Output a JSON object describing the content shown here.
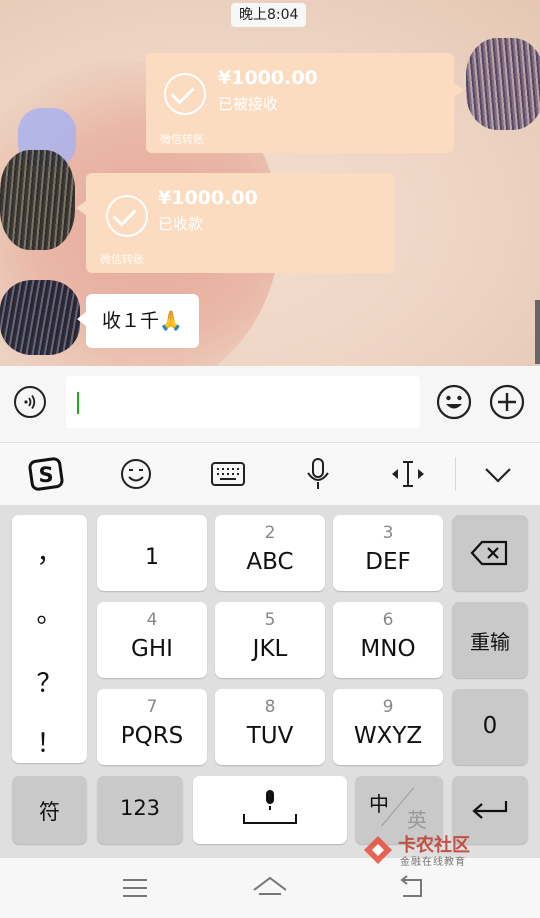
{
  "chat": {
    "timestamp": "晚上8:04",
    "transfers": [
      {
        "amount": "¥1000.00",
        "status": "已被接收",
        "footer": "微信转账"
      },
      {
        "amount": "¥1000.00",
        "status": "已收款",
        "footer": "微信转账"
      }
    ],
    "message": "收１千🙏"
  },
  "input_bar": {
    "input_value": ""
  },
  "toolbar": {
    "icons": [
      "sogou-logo-icon",
      "emoji-face-icon",
      "keyboard-icon",
      "microphone-icon",
      "cursor-move-icon",
      "chevron-down-icon"
    ]
  },
  "keyboard": {
    "punctuation": [
      "，",
      "。",
      "？",
      "！"
    ],
    "keys": [
      {
        "num": "",
        "letters": "1"
      },
      {
        "num": "2",
        "letters": "ABC"
      },
      {
        "num": "3",
        "letters": "DEF"
      },
      {
        "num": "4",
        "letters": "GHI"
      },
      {
        "num": "5",
        "letters": "JKL"
      },
      {
        "num": "6",
        "letters": "MNO"
      },
      {
        "num": "7",
        "letters": "PQRS"
      },
      {
        "num": "8",
        "letters": "TUV"
      },
      {
        "num": "9",
        "letters": "WXYZ"
      }
    ],
    "reenter_label": "重输",
    "zero_label": "0",
    "symbol_label": "符",
    "numeric_label": "123",
    "zh_label": "中",
    "en_label": "英"
  },
  "watermark": {
    "title": "卡农社区",
    "subtitle": "金融在线教育"
  },
  "colors": {
    "transfer_bg": "#fbdcc0",
    "caret": "#1aad19",
    "keyboard_bg": "#dfdfdf"
  }
}
